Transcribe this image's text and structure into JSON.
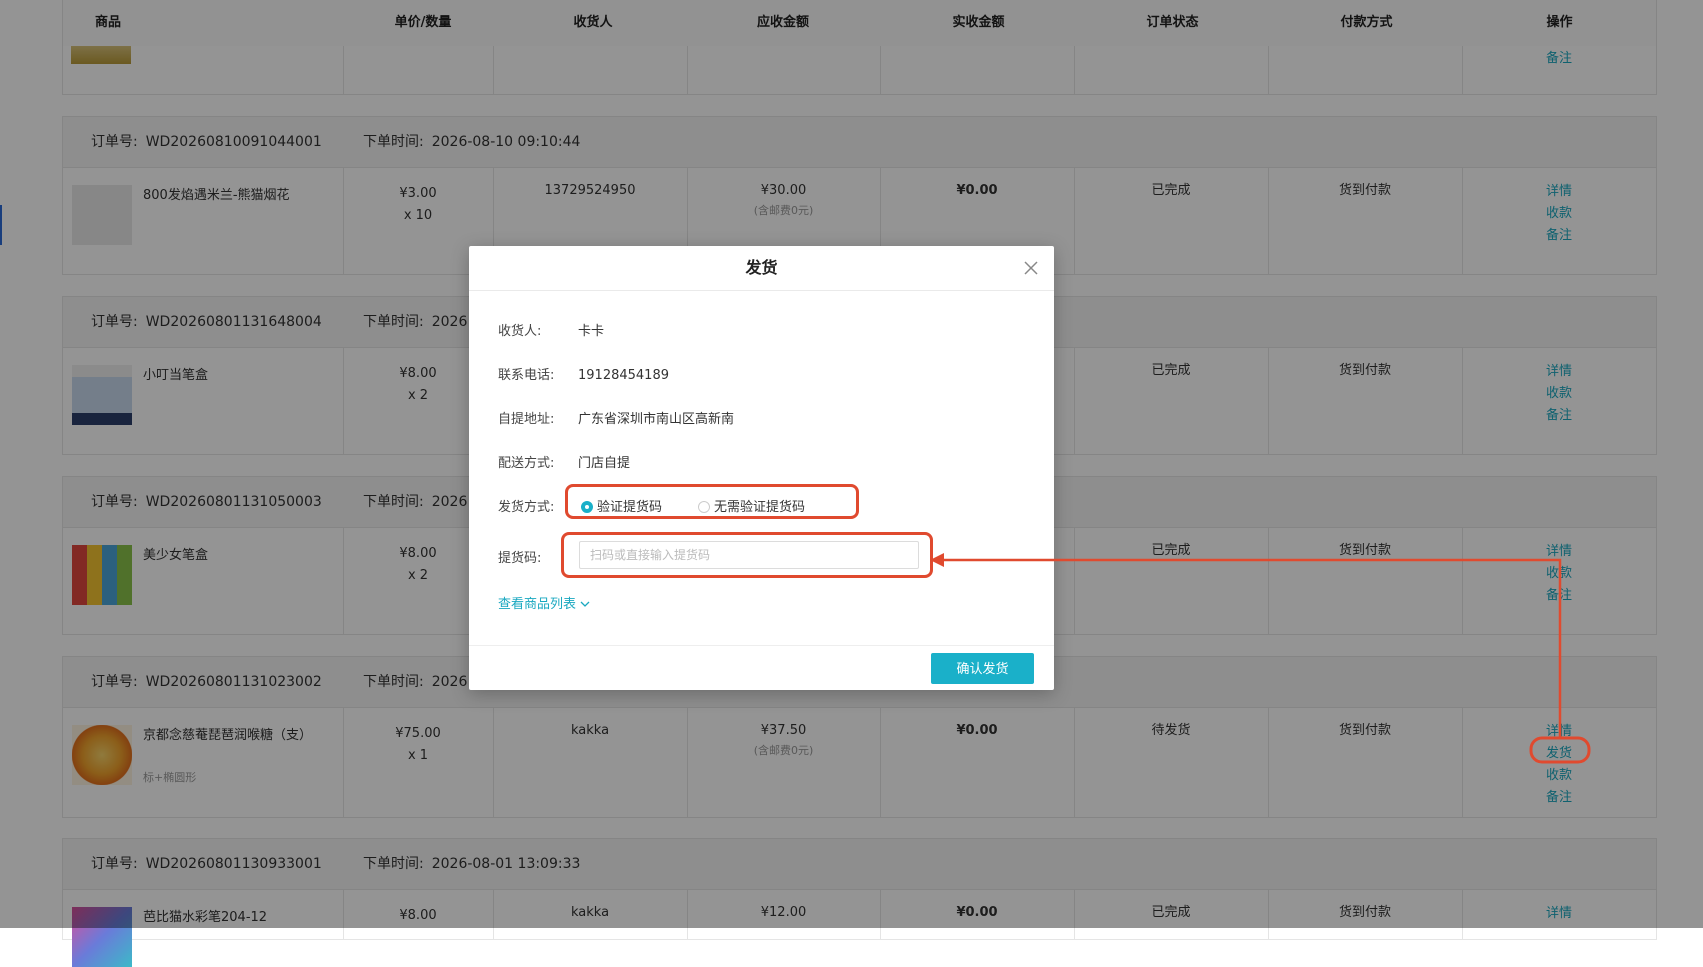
{
  "table": {
    "headers": [
      "商品",
      "单价/数量",
      "收货人",
      "应收金额",
      "实收金额",
      "订单状态",
      "付款方式",
      "操作"
    ],
    "top_partial_action": "备注"
  },
  "labels": {
    "order_no": "订单号:",
    "order_time": "下单时间:"
  },
  "orders": [
    {
      "order_no": "WD20260810091044001",
      "time": "2026-08-10 09:10:44",
      "product_name": "800发焰遇米兰-熊猫烟花",
      "product_spec": "",
      "price": "¥3.00",
      "qty": "x 10",
      "receiver": "13729524950",
      "due": "¥30.00",
      "due_note": "(含邮费0元)",
      "paid": "¥0.00",
      "status": "已完成",
      "pay_method": "货到付款",
      "actions": [
        "详情",
        "收款",
        "备注"
      ]
    },
    {
      "order_no": "WD20260801131648004",
      "time": "2026",
      "product_name": "小叮当笔盒",
      "product_spec": "",
      "price": "¥8.00",
      "qty": "x 2",
      "receiver": "",
      "due": "",
      "due_note": "",
      "paid": "",
      "status": "已完成",
      "pay_method": "货到付款",
      "actions": [
        "详情",
        "收款",
        "备注"
      ]
    },
    {
      "order_no": "WD20260801131050003",
      "time": "2026",
      "product_name": "美少女笔盒",
      "product_spec": "",
      "price": "¥8.00",
      "qty": "x 2",
      "receiver": "",
      "due": "",
      "due_note": "",
      "paid": "",
      "status": "已完成",
      "pay_method": "货到付款",
      "actions": [
        "详情",
        "收款",
        "备注"
      ]
    },
    {
      "order_no": "WD20260801131023002",
      "time": "2026",
      "product_name": "京都念慈菴琵琶润喉糖（支）",
      "product_spec": "标+椭圆形",
      "price": "¥75.00",
      "qty": "x 1",
      "receiver": "kakka",
      "due": "¥37.50",
      "due_note": "(含邮费0元)",
      "paid": "¥0.00",
      "status": "待发货",
      "pay_method": "货到付款",
      "actions": [
        "详情",
        "发货",
        "收款",
        "备注"
      ]
    },
    {
      "order_no": "WD20260801130933001",
      "time": "2026-08-01 13:09:33",
      "product_name": "芭比猫水彩笔204-12",
      "product_spec": "",
      "price": "¥8.00",
      "qty": "",
      "receiver": "kakka",
      "due": "¥12.00",
      "due_note": "",
      "paid": "¥0.00",
      "status": "已完成",
      "pay_method": "货到付款",
      "actions": [
        "详情"
      ]
    }
  ],
  "modal": {
    "title": "发货",
    "receiver_label": "收货人:",
    "receiver": "卡卡",
    "phone_label": "联系电话:",
    "phone": "19128454189",
    "address_label": "自提地址:",
    "address": "广东省深圳市南山区高新南",
    "delivery_label": "配送方式:",
    "delivery": "门店自提",
    "ship_method_label": "发货方式:",
    "option_verify": "验证提货码",
    "option_no_verify": "无需验证提货码",
    "code_label": "提货码:",
    "code_placeholder": "扫码或直接输入提货码",
    "code_value": "",
    "view_list": "查看商品列表",
    "confirm": "确认发货"
  },
  "colors": {
    "accent": "#1ab0c9",
    "annotation": "#e04a2f"
  },
  "icons": {
    "close": "close-icon",
    "chevron": "chevron-down-icon"
  }
}
